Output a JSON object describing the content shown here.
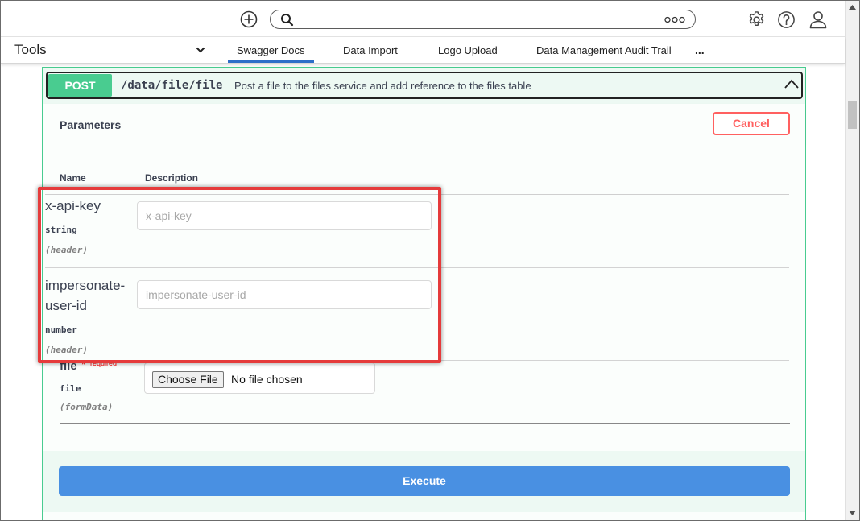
{
  "topbar": {
    "search_placeholder": "",
    "icons": [
      "add-circle-icon",
      "search-icon",
      "more-icon",
      "gear-icon",
      "help-icon",
      "user-icon"
    ]
  },
  "nav": {
    "tools_label": "Tools",
    "tabs": [
      {
        "label": "Swagger Docs",
        "active": true
      },
      {
        "label": "Data Import",
        "active": false
      },
      {
        "label": "Logo Upload",
        "active": false
      },
      {
        "label": "Data Management Audit Trail",
        "active": false
      }
    ],
    "more_label": "..."
  },
  "operation": {
    "method": "POST",
    "path": "/data/file/file",
    "description": "Post a file to the files service and add reference to the files table",
    "parameters_title": "Parameters",
    "cancel_label": "Cancel",
    "col_name": "Name",
    "col_description": "Description",
    "params": [
      {
        "name": "x-api-key",
        "type": "string",
        "in": "(header)",
        "placeholder": "x-api-key"
      },
      {
        "name_line1": "impersonate-",
        "name_line2": "user-id",
        "type": "number",
        "in": "(header)",
        "placeholder": "impersonate-user-id"
      },
      {
        "name": "file",
        "required_star": "*",
        "required_label": "required",
        "type": "file",
        "in": "(formData)",
        "choose_label": "Choose File",
        "no_file_label": "No file chosen"
      }
    ],
    "execute_label": "Execute"
  },
  "colors": {
    "post_green": "#49cc90",
    "post_bg": "#edf9f3",
    "cancel_red": "#ff6060",
    "execute_blue": "#4990e2",
    "highlight_red": "#e53b3b",
    "tab_underline": "#2d6ec9"
  }
}
